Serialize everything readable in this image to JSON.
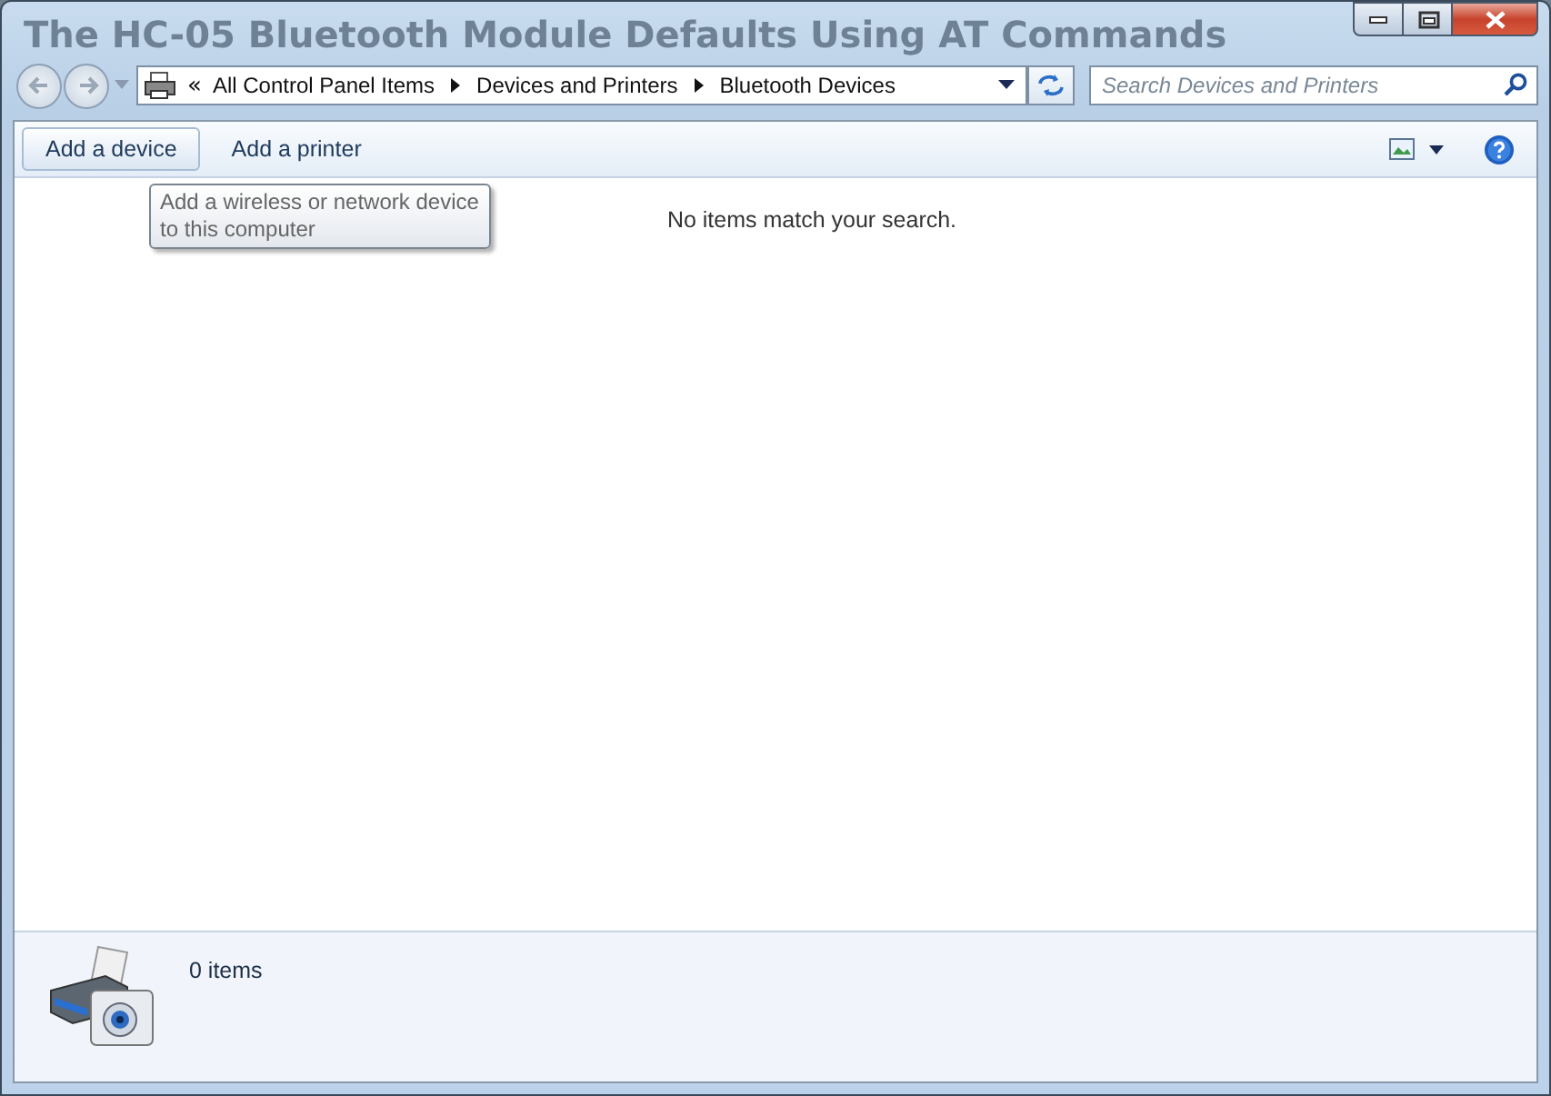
{
  "background_title": "The HC-05 Bluetooth Module Defaults Using AT Commands",
  "window_controls": [
    {
      "kind": "minimize"
    },
    {
      "kind": "maximize"
    },
    {
      "kind": "close"
    }
  ],
  "address_bar": {
    "overflow": "«",
    "crumbs": [
      "All Control Panel Items",
      "Devices and Printers",
      "Bluetooth Devices"
    ]
  },
  "search": {
    "placeholder": "Search Devices and Printers"
  },
  "toolbar": {
    "buttons": [
      {
        "label": "Add a device",
        "selected": true
      },
      {
        "label": "Add a printer",
        "selected": false
      }
    ]
  },
  "tooltip": "Add a wireless or network device to this computer",
  "content": {
    "message": "No items match your search."
  },
  "details": {
    "count": "0 items"
  }
}
